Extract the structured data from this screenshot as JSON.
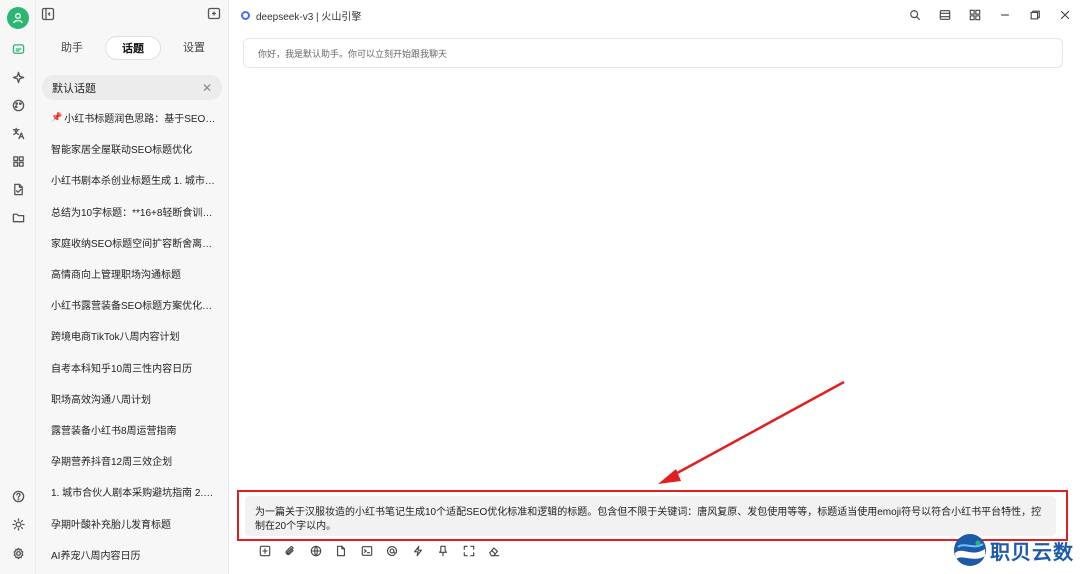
{
  "titlebar": {
    "model_label": "deepseek-v3 | 火山引擎"
  },
  "sidebar": {
    "tabs": [
      {
        "label": "助手"
      },
      {
        "label": "话题"
      },
      {
        "label": "设置"
      }
    ],
    "active_tab": "话题",
    "current_topic": "默认话题",
    "topics": [
      {
        "label": "小红书标题润色思路：基于SEO标…",
        "pinned": true
      },
      {
        "label": "智能家居全屋联动SEO标题优化"
      },
      {
        "label": "小红书剧本杀创业标题生成 1. 城市合…"
      },
      {
        "label": "总结为10字标题：**16+8轻断食训练…"
      },
      {
        "label": "家庭收纳SEO标题空间扩容断舍离优化"
      },
      {
        "label": "高情商向上管理职场沟通标题"
      },
      {
        "label": "小红书露营装备SEO标题方案优化总…"
      },
      {
        "label": "跨境电商TikTok八周内容计划"
      },
      {
        "label": "自考本科知乎10周三性内容日历"
      },
      {
        "label": "职场高效沟通八周计划"
      },
      {
        "label": "露营装备小红书8周运营指南"
      },
      {
        "label": "孕期营养抖音12周三效企划"
      },
      {
        "label": "1. 城市合伙人剧本采购避坑指南 2. 剧…"
      },
      {
        "label": "孕期叶酸补充胎儿发育标题"
      },
      {
        "label": "AI养宠八周内容日历"
      }
    ]
  },
  "chat": {
    "assistant_greeting": "你好，我是默认助手。你可以立刻开始跟我聊天",
    "input_text": "为一篇关于汉服妆造的小红书笔记生成10个适配SEO优化标准和逻辑的标题。包含但不限于关键词：唐风复原、发包使用等等，标题适当使用emoji符号以符合小红书平台特性，控制在20个字以内。"
  },
  "watermark": {
    "text": "职贝云数"
  },
  "colors": {
    "accent": "#2bb673",
    "annotation_red": "#e02020",
    "model_icon": "#4d6bfe"
  },
  "icons": {
    "rail": [
      "chat-icon",
      "sparkle-icon",
      "palette-icon",
      "translate-icon",
      "apps-icon",
      "file-icon",
      "folder-icon"
    ],
    "rail_bottom": [
      "help-icon",
      "theme-icon",
      "settings-icon"
    ],
    "toolbar": [
      "new-topic-icon",
      "attach-icon",
      "web-search-icon",
      "file-upload-icon",
      "terminal-icon",
      "mention-icon",
      "quick-phrase-icon",
      "pin-knowledge-icon",
      "expand-icon",
      "clear-icon"
    ]
  }
}
